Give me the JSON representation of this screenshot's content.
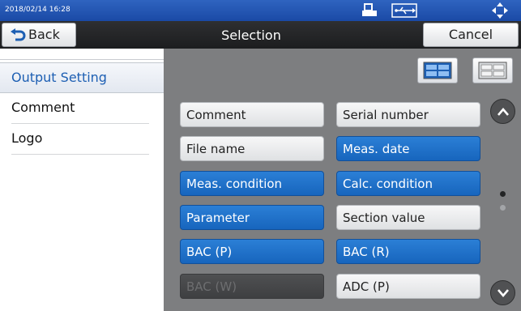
{
  "status_bar": {
    "timestamp": "2018/02/14 16:28",
    "icons": [
      "printer-icon",
      "usb-icon",
      "navigation-pad-icon"
    ]
  },
  "header": {
    "title": "Selection",
    "back_label": "Back",
    "cancel_label": "Cancel"
  },
  "sidebar": {
    "items": [
      {
        "label": "Output Setting",
        "active": true
      },
      {
        "label": "Comment",
        "active": false
      },
      {
        "label": "Logo",
        "active": false
      }
    ]
  },
  "main": {
    "view_buttons": [
      "grid-view-icon-selected",
      "grid-view-icon"
    ],
    "options": [
      {
        "label": "Comment",
        "state": "unselected"
      },
      {
        "label": "Serial number",
        "state": "unselected"
      },
      {
        "label": "File name",
        "state": "unselected"
      },
      {
        "label": "Meas. date",
        "state": "selected"
      },
      {
        "label": "Meas. condition",
        "state": "selected"
      },
      {
        "label": "Calc. condition",
        "state": "selected"
      },
      {
        "label": "Parameter",
        "state": "selected"
      },
      {
        "label": "Section value",
        "state": "unselected"
      },
      {
        "label": "BAC (P)",
        "state": "selected"
      },
      {
        "label": "BAC (R)",
        "state": "selected"
      },
      {
        "label": "BAC (W)",
        "state": "disabled"
      },
      {
        "label": "ADC (P)",
        "state": "unselected"
      }
    ],
    "scroll": {
      "pages": 2,
      "current_page": 1
    }
  },
  "colors": {
    "status_bar": "#1f55b3",
    "selected": "#1b6ac4",
    "active_side_text": "#1d5fb3",
    "background": "#7d7e80"
  }
}
